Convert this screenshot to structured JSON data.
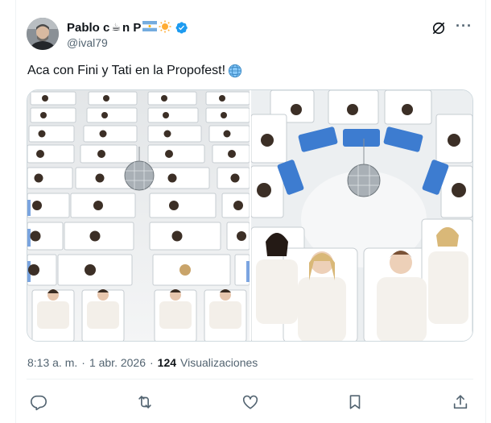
{
  "post": {
    "author": {
      "display_name": "Pablo c",
      "name_middle": "n P",
      "emojis": [
        "☕",
        "🇦🇷",
        "☀"
      ],
      "handle": "@ival79",
      "verified": true,
      "avatar_icon": "avatar"
    },
    "text": "Aca con Fini y Tati en la Propofest!",
    "text_emoji": "🌐",
    "media": [
      {
        "description_icon": "hospital-beds-grid-photo"
      },
      {
        "description_icon": "hospital-beds-circle-photo"
      }
    ],
    "time": "8:13 a. m.",
    "separator": "·",
    "date": "1 abr. 2026",
    "views_count": "124",
    "views_label": "Visualizaciones"
  },
  "actions": [
    {
      "name": "reply",
      "icon": "reply-icon"
    },
    {
      "name": "repost",
      "icon": "repost-icon"
    },
    {
      "name": "like",
      "icon": "heart-icon"
    },
    {
      "name": "bookmark",
      "icon": "bookmark-icon"
    },
    {
      "name": "share",
      "icon": "share-icon"
    }
  ],
  "colors": {
    "text": "#0f1419",
    "muted": "#536471",
    "verified": "#1d9bf0",
    "border": "#cfd9de"
  }
}
